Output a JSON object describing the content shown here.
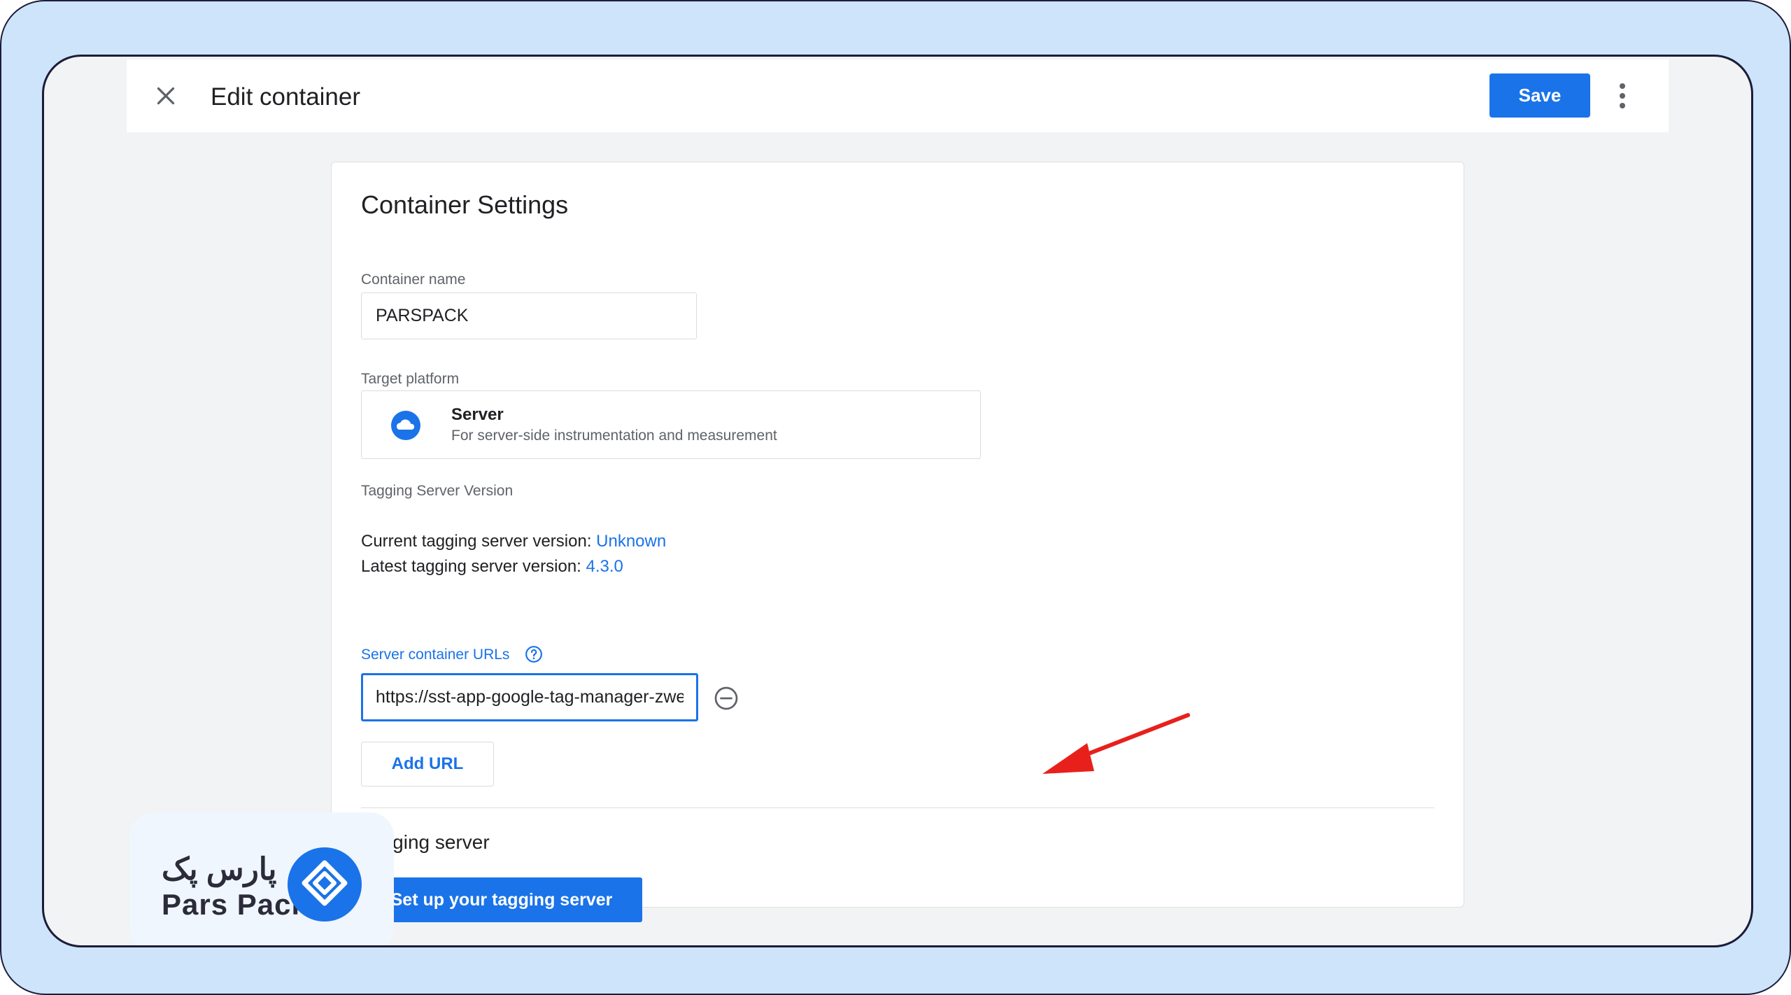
{
  "header": {
    "title": "Edit container",
    "save_label": "Save",
    "close_icon": "close-icon",
    "more_icon": "more-vert-icon"
  },
  "settings": {
    "title": "Container Settings",
    "container_name_label": "Container name",
    "container_name_value": "PARSPACK",
    "target_platform_label": "Target platform",
    "platform": {
      "name": "Server",
      "description": "For server-side instrumentation and measurement",
      "icon": "cloud-icon"
    },
    "tagging_version_label": "Tagging Server Version",
    "current_version_label": "Current tagging server version: ",
    "current_version_value": "Unknown",
    "latest_version_label": "Latest tagging server version: ",
    "latest_version_value": "4.3.0",
    "urls_label": "Server container URLs",
    "url_value": "https://sst-app-google-tag-manager-zwe",
    "add_url_label": "Add URL"
  },
  "tagging_server": {
    "title": "Tagging server",
    "setup_label": "Set up your tagging server"
  },
  "logo": {
    "text_fa": "پارس پک",
    "text_en": "Pars Pack"
  },
  "colors": {
    "accent": "#1a73e8",
    "frame_bg": "#cde4fb",
    "arrow": "#e8201c"
  }
}
